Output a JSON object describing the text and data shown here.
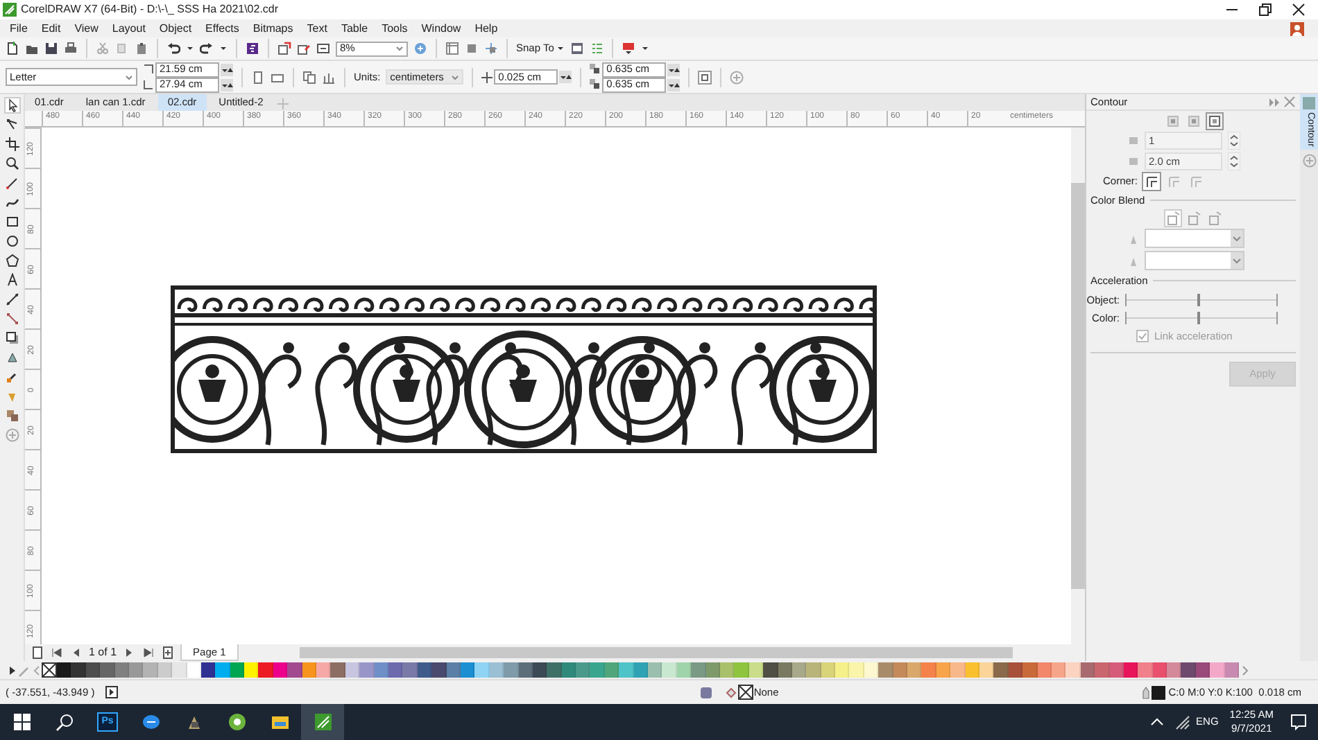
{
  "window": {
    "title": "CorelDRAW X7 (64-Bit) - D:\\-\\_ SSS Ha 2021\\02.cdr"
  },
  "menu": [
    {
      "label": "File"
    },
    {
      "label": "Edit"
    },
    {
      "label": "View"
    },
    {
      "label": "Layout"
    },
    {
      "label": "Object"
    },
    {
      "label": "Effects"
    },
    {
      "label": "Bitmaps"
    },
    {
      "label": "Text"
    },
    {
      "label": "Table"
    },
    {
      "label": "Tools"
    },
    {
      "label": "Window"
    },
    {
      "label": "Help"
    }
  ],
  "standard_toolbar": {
    "zoom": "8%",
    "snap": "Snap To"
  },
  "property_bar": {
    "paper": "Letter",
    "width": "21.59 cm",
    "height": "27.94 cm",
    "units_label": "Units:",
    "units": "centimeters",
    "nudge": "0.025 cm",
    "duplicate_x": "0.635 cm",
    "duplicate_y": "0.635 cm"
  },
  "document_tabs": [
    {
      "label": "01.cdr",
      "selected": false
    },
    {
      "label": "lan can 1.cdr",
      "selected": false
    },
    {
      "label": "02.cdr",
      "selected": true
    },
    {
      "label": "Untitled-2",
      "selected": false
    }
  ],
  "horizontal_ruler": {
    "labels": [
      "480",
      "460",
      "440",
      "420",
      "400",
      "380",
      "360",
      "340",
      "320",
      "300",
      "280",
      "260",
      "240",
      "220",
      "200",
      "180",
      "160",
      "140",
      "120",
      "100",
      "80",
      "60",
      "40",
      "20"
    ],
    "unit": "centimeters"
  },
  "vertical_ruler": {
    "labels": [
      "120",
      "100",
      "80",
      "60",
      "40",
      "20",
      "0",
      "20",
      "40",
      "60",
      "80",
      "100",
      "120"
    ]
  },
  "page_navigator": {
    "counter": "1 of 1",
    "page_tab": "Page 1"
  },
  "docker": {
    "title": "Contour",
    "side_tab": "Contour",
    "steps": "1",
    "offset": "2.0 cm",
    "corner_label": "Corner:",
    "color_blend": "Color Blend",
    "acceleration": "Acceleration",
    "sliders": [
      {
        "label": "Object:",
        "level": 0.47
      },
      {
        "label": "Color:",
        "level": 0.47
      }
    ],
    "link_acceleration": {
      "label": "Link acceleration",
      "checked": true,
      "disabled": true
    },
    "apply": {
      "label": "Apply",
      "disabled": true
    }
  },
  "palette": [
    {
      "color": "#1a1a1a"
    },
    {
      "color": "#333333"
    },
    {
      "color": "#4d4d4d"
    },
    {
      "color": "#666666"
    },
    {
      "color": "#808080"
    },
    {
      "color": "#999999"
    },
    {
      "color": "#b3b3b3"
    },
    {
      "color": "#cccccc"
    },
    {
      "color": "#e6e6e6"
    },
    {
      "color": "#ffffff"
    },
    {
      "color": "#2e3192"
    },
    {
      "color": "#00aeef"
    },
    {
      "color": "#00a651"
    },
    {
      "color": "#fff200"
    },
    {
      "color": "#ed1c24"
    },
    {
      "color": "#ec008c"
    },
    {
      "color": "#a3498f"
    },
    {
      "color": "#f7941d"
    },
    {
      "color": "#f5a9a6"
    },
    {
      "color": "#8c6e63"
    },
    {
      "color": "#c7c5e0"
    },
    {
      "color": "#9896c8"
    },
    {
      "color": "#6f8fc9"
    },
    {
      "color": "#6d6aae"
    },
    {
      "color": "#7a7aa8"
    },
    {
      "color": "#3f5b8c"
    },
    {
      "color": "#4a4a6e"
    },
    {
      "color": "#5b7fa6"
    },
    {
      "color": "#1b8fd2"
    },
    {
      "color": "#8fd3f4"
    },
    {
      "color": "#9bbfd3"
    },
    {
      "color": "#7f9aa8"
    },
    {
      "color": "#5c6e7a"
    },
    {
      "color": "#3b4a55"
    },
    {
      "color": "#3e7068"
    },
    {
      "color": "#2f8a7c"
    },
    {
      "color": "#4a9a8c"
    },
    {
      "color": "#3aa58f"
    },
    {
      "color": "#4fa67a"
    },
    {
      "color": "#4ec3c8"
    },
    {
      "color": "#2fa3b3"
    },
    {
      "color": "#9bbfae"
    },
    {
      "color": "#c9e8d0"
    },
    {
      "color": "#9fd4aa"
    },
    {
      "color": "#7a9a86"
    },
    {
      "color": "#7f9a6a"
    },
    {
      "color": "#a9c16a"
    },
    {
      "color": "#8fc43f"
    },
    {
      "color": "#c9dd8a"
    },
    {
      "color": "#4f4f45"
    },
    {
      "color": "#7a7a62"
    },
    {
      "color": "#a8a88a"
    },
    {
      "color": "#b9b47a"
    },
    {
      "color": "#d9d37a"
    },
    {
      "color": "#f6f08a"
    },
    {
      "color": "#faf5a8"
    },
    {
      "color": "#fdf8d0"
    },
    {
      "color": "#a88c6a"
    },
    {
      "color": "#c48a5a"
    },
    {
      "color": "#d9a86a"
    },
    {
      "color": "#f4824a"
    },
    {
      "color": "#f7a44a"
    },
    {
      "color": "#f9b88a"
    },
    {
      "color": "#fbc02d"
    },
    {
      "color": "#fbd49a"
    },
    {
      "color": "#8a6a4a"
    },
    {
      "color": "#a8503a"
    },
    {
      "color": "#c96a3a"
    },
    {
      "color": "#f2876a"
    },
    {
      "color": "#f7a58a"
    },
    {
      "color": "#fbd3c0"
    },
    {
      "color": "#a86a6e"
    },
    {
      "color": "#c9666e"
    },
    {
      "color": "#d65a7a"
    },
    {
      "color": "#e8155a"
    },
    {
      "color": "#f0808a"
    },
    {
      "color": "#e8506e"
    },
    {
      "color": "#d48a9a"
    },
    {
      "color": "#6e4a6e"
    },
    {
      "color": "#9a4a7a"
    },
    {
      "color": "#f4a8c8"
    },
    {
      "color": "#c88ab0"
    }
  ],
  "status_bar": {
    "coordinates": "( -37.551, -43.949 )",
    "fill": "None",
    "outline": "C:0 M:0 Y:0 K:100  0.018 cm"
  },
  "taskbar": {
    "photoshop": "Ps",
    "language": "ENG",
    "time": "12:25 AM",
    "date": "9/7/2021"
  }
}
